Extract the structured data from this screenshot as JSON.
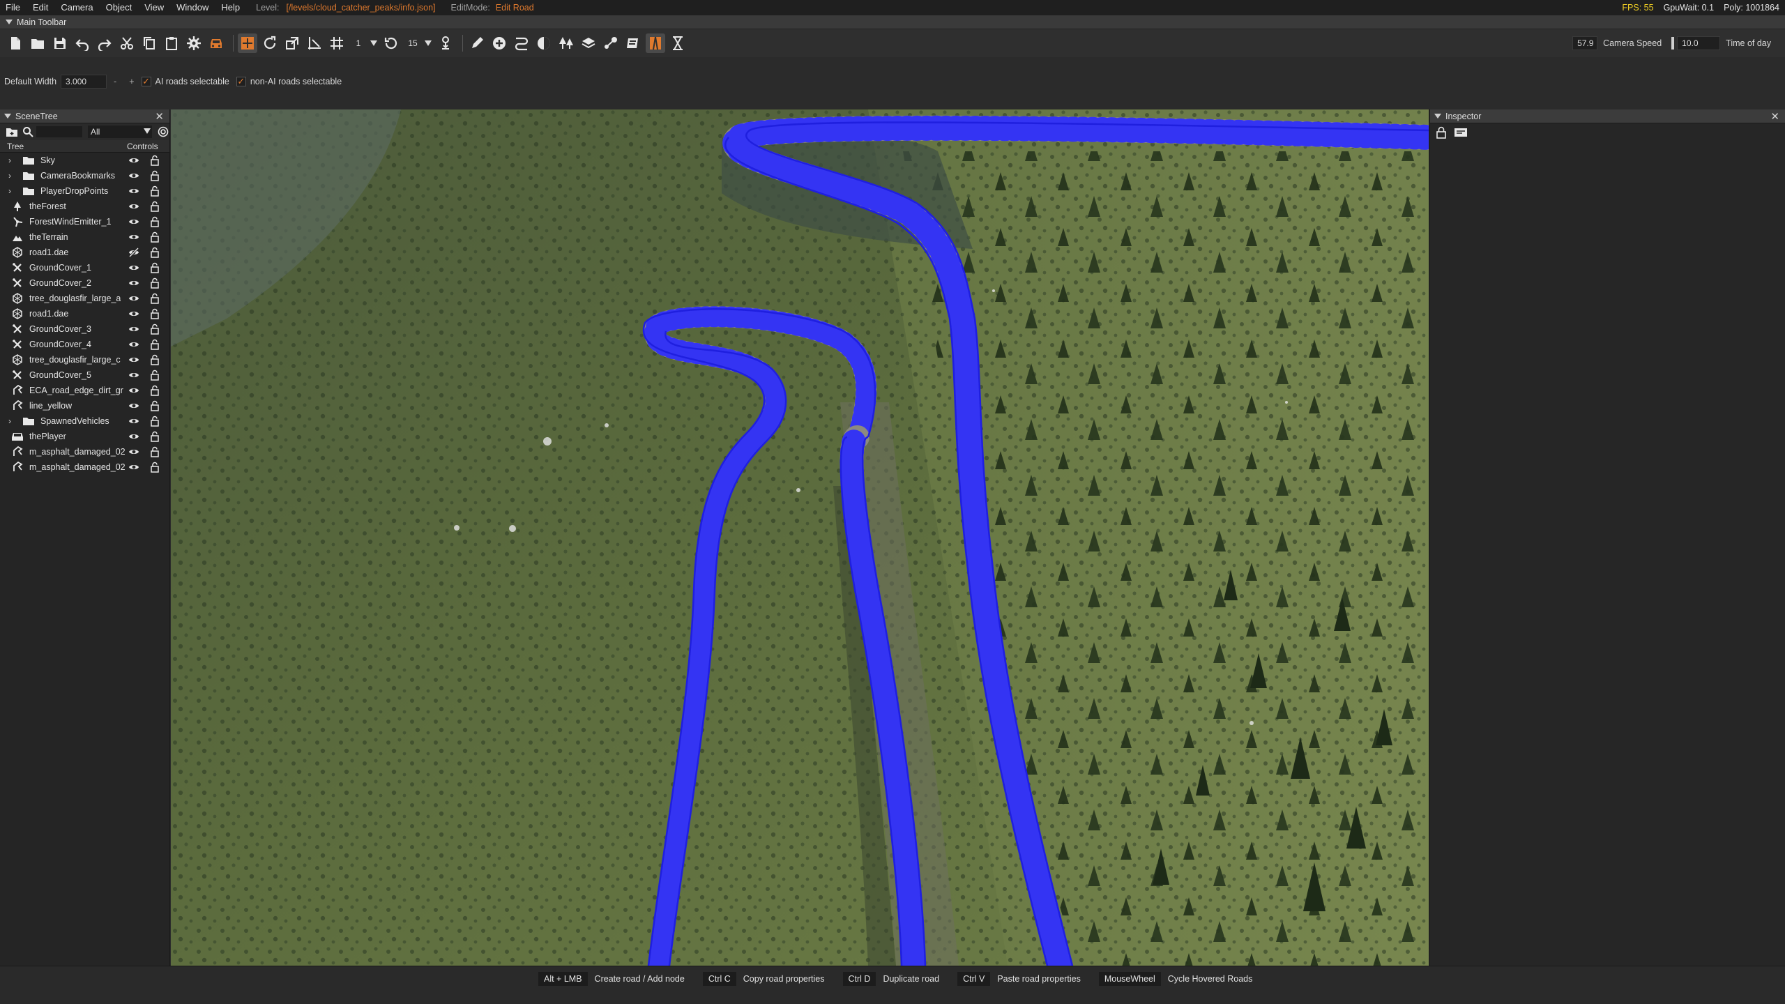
{
  "menu": {
    "items": [
      "File",
      "Edit",
      "Camera",
      "Object",
      "View",
      "Window",
      "Help"
    ],
    "level_label": "Level:",
    "level_path": "[/levels/cloud_catcher_peaks/info.json]",
    "editmode_label": "EditMode:",
    "editmode_value": "Edit Road",
    "fps": "FPS: 55",
    "gpuwait": "GpuWait: 0.1",
    "poly": "Poly: 1001864"
  },
  "toolbar": {
    "title": "Main Toolbar",
    "snap_value": "1",
    "rotate_value": "15",
    "camera_speed_value": "57.9",
    "camera_speed_label": "Camera Speed",
    "time_value": "10.0",
    "time_label": "Time of day"
  },
  "road_options": {
    "default_width_label": "Default Width",
    "default_width_value": "3.000",
    "minus": "-",
    "plus": "+",
    "ai_roads_label": "AI roads selectable",
    "non_ai_roads_label": "non-AI roads selectable"
  },
  "scenetree": {
    "title": "SceneTree",
    "filter_value": "All",
    "col_tree": "Tree",
    "col_controls": "Controls",
    "items": [
      {
        "label": "Sky",
        "icon": "folder-icon",
        "folder": true,
        "visible": true
      },
      {
        "label": "CameraBookmarks",
        "icon": "folder-icon",
        "folder": true,
        "visible": true
      },
      {
        "label": "PlayerDropPoints",
        "icon": "folder-icon",
        "folder": true,
        "visible": true
      },
      {
        "label": "theForest",
        "icon": "forest-icon",
        "folder": false,
        "visible": true
      },
      {
        "label": "ForestWindEmitter_1",
        "icon": "wind-icon",
        "folder": false,
        "visible": true
      },
      {
        "label": "theTerrain",
        "icon": "terrain-icon",
        "folder": false,
        "visible": true
      },
      {
        "label": "road1.dae",
        "icon": "mesh-icon",
        "folder": false,
        "visible": false
      },
      {
        "label": "GroundCover_1",
        "icon": "groundcover-icon",
        "folder": false,
        "visible": true
      },
      {
        "label": "GroundCover_2",
        "icon": "groundcover-icon",
        "folder": false,
        "visible": true
      },
      {
        "label": "tree_douglasfir_large_a",
        "icon": "mesh-icon",
        "folder": false,
        "visible": true
      },
      {
        "label": "road1.dae",
        "icon": "mesh-icon",
        "folder": false,
        "visible": true
      },
      {
        "label": "GroundCover_3",
        "icon": "groundcover-icon",
        "folder": false,
        "visible": true
      },
      {
        "label": "GroundCover_4",
        "icon": "groundcover-icon",
        "folder": false,
        "visible": true
      },
      {
        "label": "tree_douglasfir_large_c",
        "icon": "mesh-icon",
        "folder": false,
        "visible": true
      },
      {
        "label": "GroundCover_5",
        "icon": "groundcover-icon",
        "folder": false,
        "visible": true
      },
      {
        "label": "ECA_road_edge_dirt_gr",
        "icon": "decal-road-icon",
        "folder": false,
        "visible": true
      },
      {
        "label": "line_yellow",
        "icon": "decal-road-icon",
        "folder": false,
        "visible": true
      },
      {
        "label": "SpawnedVehicles",
        "icon": "folder-icon",
        "folder": true,
        "visible": true
      },
      {
        "label": "thePlayer",
        "icon": "vehicle-icon",
        "folder": false,
        "visible": true
      },
      {
        "label": "m_asphalt_damaged_02",
        "icon": "decal-road-icon",
        "folder": false,
        "visible": true
      },
      {
        "label": "m_asphalt_damaged_02",
        "icon": "decal-road-icon",
        "folder": false,
        "visible": true
      }
    ]
  },
  "inspector": {
    "title": "Inspector"
  },
  "status_hints": [
    {
      "key": "Alt + LMB",
      "action": "Create road / Add node"
    },
    {
      "key": "Ctrl C",
      "action": "Copy road properties"
    },
    {
      "key": "Ctrl D",
      "action": "Duplicate road"
    },
    {
      "key": "Ctrl V",
      "action": "Paste road properties"
    },
    {
      "key": "MouseWheel",
      "action": "Cycle Hovered Roads"
    }
  ],
  "colors": {
    "accent": "#e07a2e",
    "fps": "#f2d024",
    "road_spline": "#2a2aff"
  }
}
